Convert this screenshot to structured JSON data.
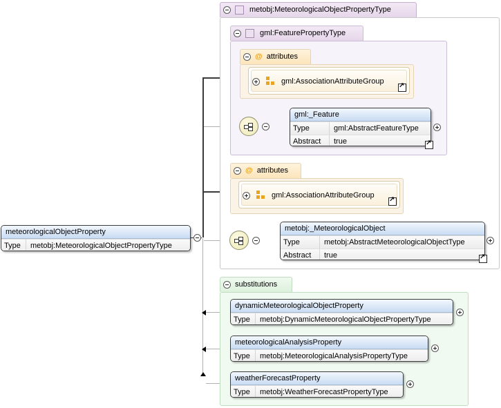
{
  "root": {
    "name": "meteorologicalObjectProperty",
    "type_label": "Type",
    "type_value": "metobj:MeteorologicalObjectPropertyType"
  },
  "complex_type": {
    "name": "metobj:MeteorologicalObjectPropertyType"
  },
  "feature_property": {
    "name": "gml:FeaturePropertyType",
    "attributes_label": "attributes",
    "attribute_group": "gml:AssociationAttributeGroup",
    "element": {
      "name": "gml:_Feature",
      "type_label": "Type",
      "type_value": "gml:AbstractFeatureType",
      "abstract_label": "Abstract",
      "abstract_value": "true"
    }
  },
  "own_attributes": {
    "label": "attributes",
    "attribute_group": "gml:AssociationAttributeGroup"
  },
  "met_element": {
    "name": "metobj:_MeteorologicalObject",
    "type_label": "Type",
    "type_value": "metobj:AbstractMeteorologicalObjectType",
    "abstract_label": "Abstract",
    "abstract_value": "true"
  },
  "substitutions": {
    "label": "substitutions",
    "items": [
      {
        "name": "dynamicMeteorologicalObjectProperty",
        "type_label": "Type",
        "type_value": "metobj:DynamicMeteorologicalObjectPropertyType"
      },
      {
        "name": "meteorologicalAnalysisProperty",
        "type_label": "Type",
        "type_value": "metobj:MeteorologicalAnalysisPropertyType"
      },
      {
        "name": "weatherForecastProperty",
        "type_label": "Type",
        "type_value": "metobj:WeatherForecastPropertyType"
      }
    ]
  },
  "colors": {
    "element_header": "#c9dcf3",
    "complex_type_tab": "#e6d6ea",
    "attributes_tab": "#fbe5bb",
    "substitutions_tab": "#ddf0dd",
    "attribute_icon": "#e9a51f"
  }
}
